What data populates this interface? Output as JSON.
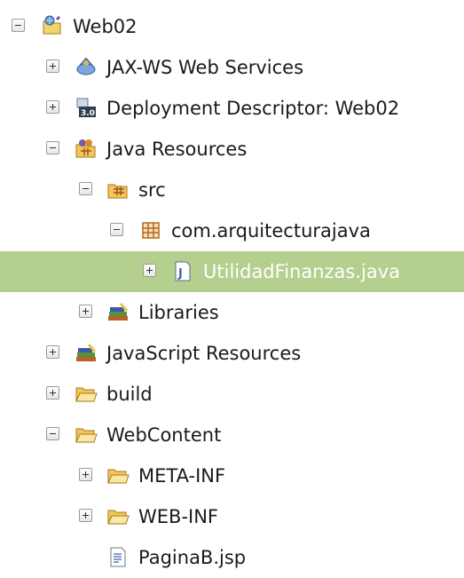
{
  "tree": {
    "nodes": [
      {
        "label": "Web02",
        "toggle": "minus",
        "icon": "web-project-icon"
      },
      {
        "label": "JAX-WS Web Services",
        "toggle": "plus",
        "icon": "web-services-icon"
      },
      {
        "label": "Deployment Descriptor: Web02",
        "toggle": "plus",
        "icon": "deployment-descriptor-icon"
      },
      {
        "label": "Java Resources",
        "toggle": "minus",
        "icon": "java-resources-icon"
      },
      {
        "label": "src",
        "toggle": "minus",
        "icon": "source-folder-icon"
      },
      {
        "label": "com.arquitecturajava",
        "toggle": "minus",
        "icon": "package-icon"
      },
      {
        "label": "UtilidadFinanzas.java",
        "toggle": "plus",
        "icon": "java-file-icon",
        "selected": true
      },
      {
        "label": "Libraries",
        "toggle": "plus",
        "icon": "libraries-icon"
      },
      {
        "label": "JavaScript Resources",
        "toggle": "plus",
        "icon": "libraries-icon"
      },
      {
        "label": "build",
        "toggle": "plus",
        "icon": "folder-icon"
      },
      {
        "label": "WebContent",
        "toggle": "minus",
        "icon": "folder-icon"
      },
      {
        "label": "META-INF",
        "toggle": "plus",
        "icon": "folder-icon"
      },
      {
        "label": "WEB-INF",
        "toggle": "plus",
        "icon": "folder-icon"
      },
      {
        "label": "PaginaB.jsp",
        "toggle": "none",
        "icon": "jsp-file-icon"
      }
    ]
  },
  "colors": {
    "selection": "#b5cf8f",
    "selected_text": "#ffffff"
  }
}
